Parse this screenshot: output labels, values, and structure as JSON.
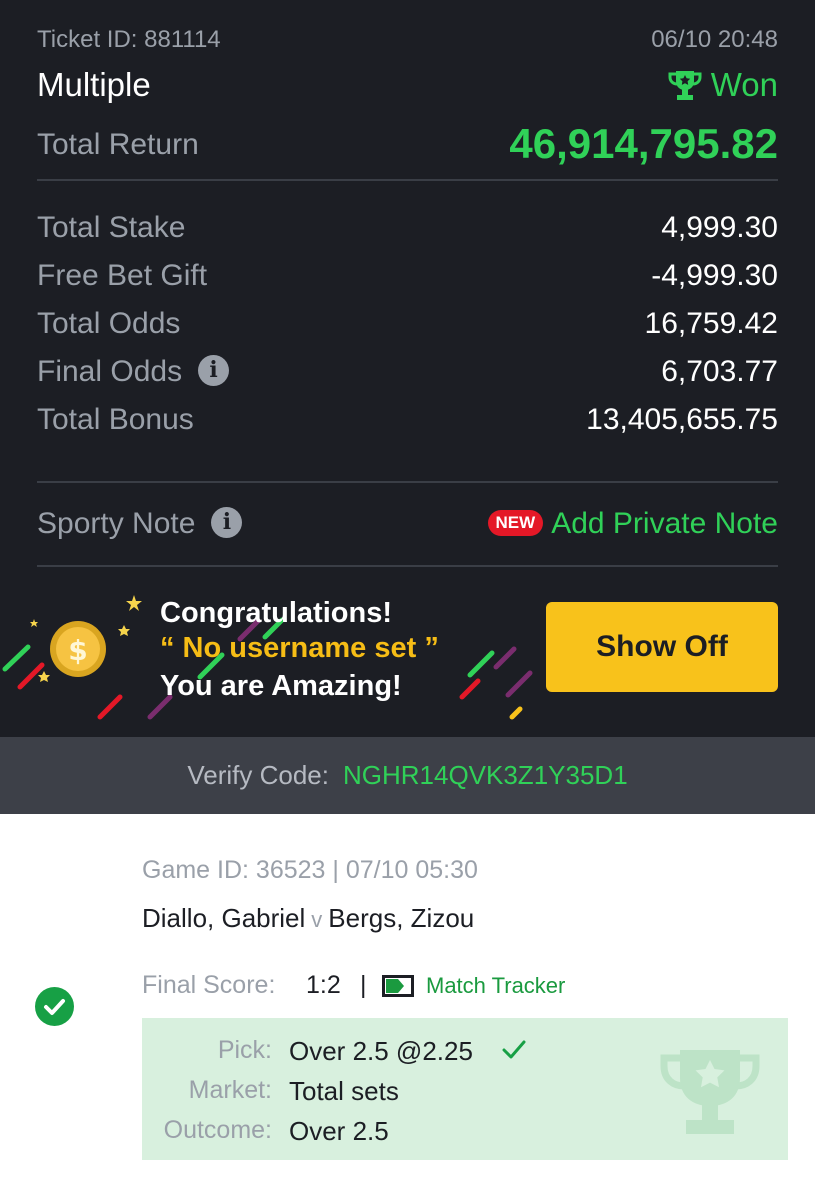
{
  "header": {
    "ticket_id": "Ticket ID: 881114",
    "datetime": "06/10 20:48",
    "bet_type": "Multiple",
    "status": "Won"
  },
  "summary": {
    "total_return_label": "Total Return",
    "total_return_value": "46,914,795.82",
    "rows": [
      {
        "label": "Total Stake",
        "value": "4,999.30"
      },
      {
        "label": "Free Bet Gift",
        "value": "-4,999.30"
      },
      {
        "label": "Total Odds",
        "value": "16,759.42"
      },
      {
        "label": "Final Odds",
        "value": "6,703.77"
      },
      {
        "label": "Total Bonus",
        "value": "13,405,655.75"
      }
    ]
  },
  "note": {
    "label": "Sporty Note",
    "badge": "NEW",
    "action": "Add Private Note"
  },
  "banner": {
    "line1": "Congratulations!",
    "line2": "“ No username set ”",
    "line3": "You are Amazing!",
    "button": "Show Off"
  },
  "verify": {
    "label": "Verify Code:",
    "code": "NGHR14QVK3Z1Y35D1"
  },
  "game": {
    "game_id": "Game ID: 36523 | 07/10 05:30",
    "home": "Diallo, Gabriel",
    "vs": "v",
    "away": "Bergs, Zizou",
    "final_label": "Final Score:",
    "final_score": "1:2",
    "separator": "|",
    "tracker": "Match Tracker",
    "pick_label": "Pick:",
    "pick_value": "Over 2.5 @2.25",
    "market_label": "Market:",
    "market_value": "Total sets",
    "outcome_label": "Outcome:",
    "outcome_value": "Over 2.5"
  },
  "colors": {
    "accent_green": "#30d158",
    "button_yellow": "#f8c21b",
    "badge_red": "#e41827",
    "background_dark": "#1c1e24"
  }
}
